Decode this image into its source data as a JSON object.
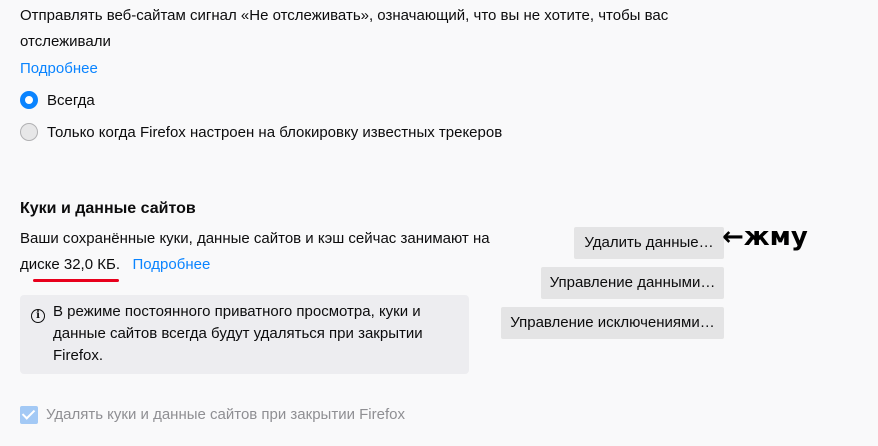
{
  "dnt": {
    "description_line1": "Отправлять веб-сайтам сигнал «Не отслеживать», означающий, что вы не хотите, чтобы вас",
    "description_line2": "отслеживали",
    "learn_more": "Подробнее",
    "options": [
      {
        "label": "Всегда",
        "checked": true
      },
      {
        "label": "Только когда Firefox настроен на блокировку известных трекеров",
        "checked": false
      }
    ]
  },
  "cookies": {
    "title": "Куки и данные сайтов",
    "usage_line1": "Ваши сохранённые куки, данные сайтов и кэш сейчас занимают на",
    "usage_prefix": "диске ",
    "usage_size": "32,0 КБ.",
    "learn_more": "Подробнее",
    "buttons": {
      "clear_data": "Удалить данные…",
      "manage_data": "Управление данными…",
      "manage_exceptions": "Управление исключениями…"
    },
    "info_icon": "info-icon",
    "info_text": "В режиме постоянного приватного просмотра, куки и данные сайтов всегда будут удаляться при закрытии Firefox.",
    "delete_on_close": {
      "label": "Удалять куки и данные сайтов при закрытии Firefox",
      "checked": true,
      "disabled": true
    }
  },
  "annotation": {
    "arrow": "←",
    "text": "жму",
    "underline_color": "#e8001c"
  },
  "colors": {
    "accent": "#0a84ff",
    "background": "#f9f9fa",
    "button": "#e4e4e5",
    "info_box": "#ededf0"
  }
}
